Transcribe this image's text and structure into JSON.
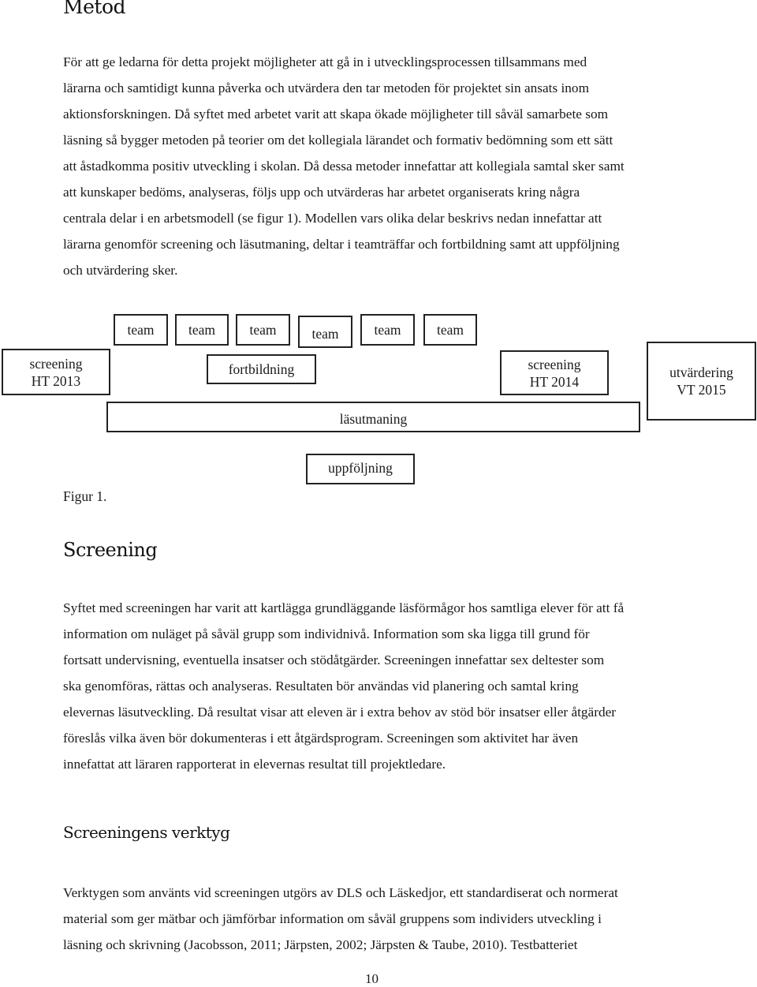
{
  "sections": {
    "metod": {
      "heading": "Metod",
      "lines": [
        "För att ge ledarna för detta projekt möjligheter att gå in i utvecklingsprocessen tillsammans med",
        "lärarna och samtidigt kunna påverka och utvärdera den tar metoden för projektet sin ansats inom",
        "aktionsforskningen. Då syftet med arbetet varit att skapa ökade möjligheter till såväl samarbete som",
        "läsning så bygger metoden på teorier om det kollegiala lärandet och formativ bedömning som ett sätt",
        "att åstadkomma positiv utveckling i skolan. Då dessa metoder innefattar att kollegiala samtal sker samt",
        "att kunskaper bedöms, analyseras, följs upp och utvärderas har arbetet organiserats kring några",
        "centrala delar i en arbetsmodell (se figur 1). Modellen vars olika delar beskrivs nedan innefattar att",
        "lärarna genomför screening och läsutmaning, deltar i teamträffar och fortbildning samt att uppföljning",
        "och utvärdering sker."
      ]
    },
    "screening": {
      "heading": "Screening",
      "lines": [
        "Syftet med screeningen har varit att kartlägga grundläggande läsförmågor hos samtliga elever för att få",
        "information om nuläget på såväl grupp som individnivå. Information som ska ligga till grund för",
        "fortsatt undervisning, eventuella insatser och stödåtgärder. Screeningen innefattar sex deltester som",
        "ska genomföras, rättas och analyseras. Resultaten bör användas vid planering och samtal kring",
        "elevernas läsutveckling. Då resultat visar att eleven är i extra behov av stöd bör insatser eller åtgärder",
        "föreslås vilka även bör dokumenteras i ett åtgärdsprogram. Screeningen som aktivitet har även",
        "innefattat att läraren rapporterat in elevernas resultat till projektledare."
      ]
    },
    "verktyg": {
      "heading": "Screeningens verktyg",
      "lines": [
        "Verktygen som använts vid screeningen utgörs av DLS och Läskedjor, ett standardiserat och normerat",
        "material som ger mätbar och jämförbar information om såväl gruppens som individers utveckling i",
        "läsning och skrivning (Jacobsson, 2011; Järpsten, 2002; Järpsten & Taube, 2010). Testbatteriet"
      ]
    }
  },
  "figure": {
    "caption": "Figur 1.",
    "team_boxes": [
      "team",
      "team",
      "team",
      "team",
      "team",
      "team"
    ],
    "screening_2013": {
      "line1": "screening",
      "line2": "HT 2013"
    },
    "fortbildning": "fortbildning",
    "screening_2014": {
      "line1": "screening",
      "line2": "HT 2014"
    },
    "utvardering": {
      "line1": "utvärdering",
      "line2": "VT 2015"
    },
    "lasutmaning": "läsutmaning",
    "uppfoljning": "uppföljning"
  },
  "page_number": "10"
}
